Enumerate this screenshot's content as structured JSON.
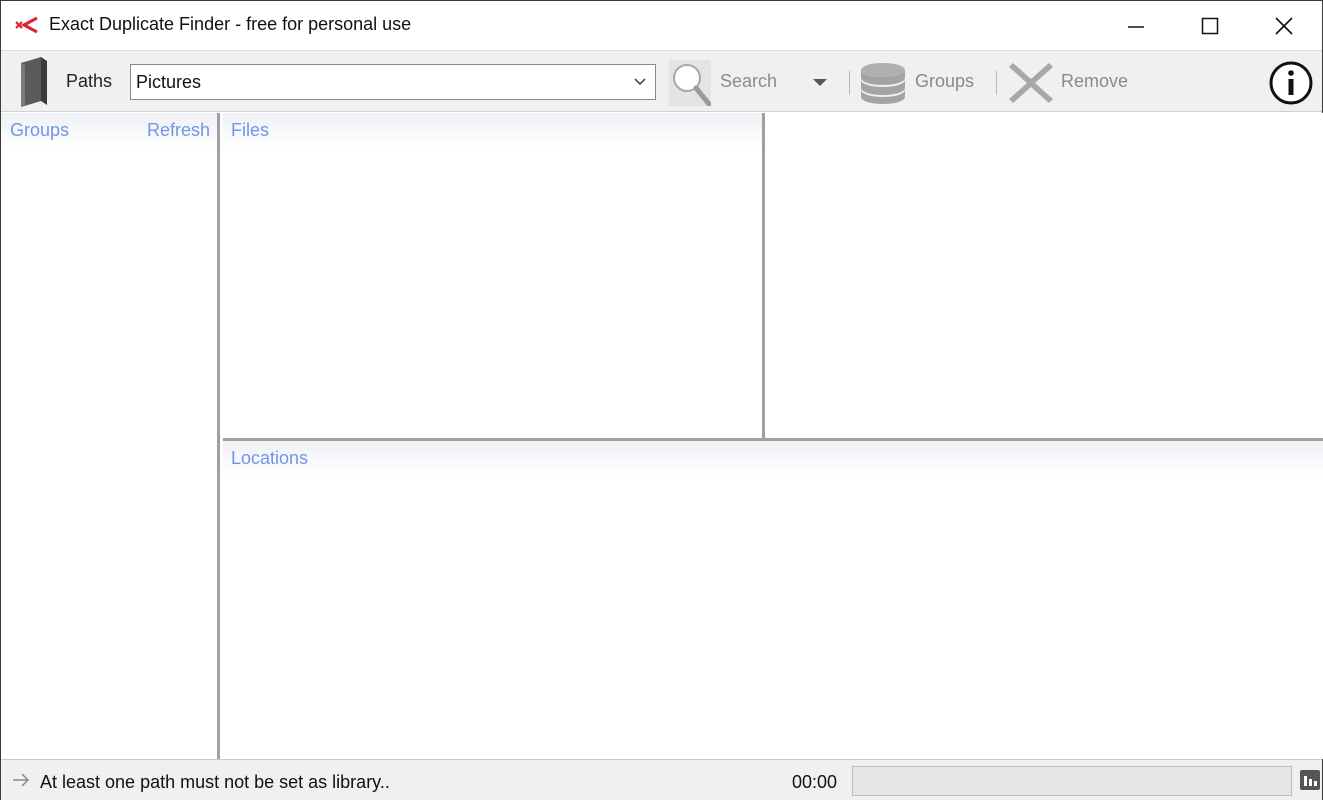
{
  "window": {
    "title": "Exact Duplicate Finder - free for personal use",
    "controls": {
      "minimize": "minimize-icon",
      "maximize": "maximize-icon",
      "close": "close-icon"
    }
  },
  "toolbar": {
    "paths_label": "Paths",
    "path_value": "Pictures",
    "search_label": "Search",
    "groups_label": "Groups",
    "remove_label": "Remove",
    "icons": [
      "folder-icon",
      "search-icon",
      "dropdown-arrow-icon",
      "database-icon",
      "remove-icon",
      "info-icon"
    ]
  },
  "groups_panel": {
    "title": "Groups",
    "refresh_label": "Refresh"
  },
  "files_panel": {
    "title": "Files"
  },
  "locations_panel": {
    "title": "Locations"
  },
  "statusbar": {
    "message": "At least one path must not be set as library..",
    "elapsed": "00:00",
    "progress": 0
  },
  "colors": {
    "header_text": "#6f96e8",
    "app_icon": "#d9232e",
    "disabled_text": "#8a8a8a",
    "splitter": "#a0a0a0"
  }
}
